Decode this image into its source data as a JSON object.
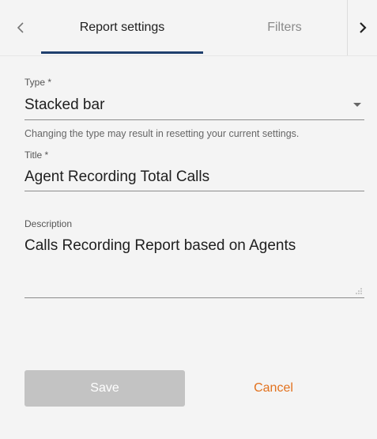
{
  "tabs": {
    "items": [
      {
        "label": "Report settings",
        "active": true
      },
      {
        "label": "Filters",
        "active": false
      }
    ]
  },
  "icons": {
    "prev": "chevron-left-icon",
    "next": "chevron-right-icon",
    "dropdown": "caret-down-icon",
    "resize": "resize-handle-icon"
  },
  "form": {
    "type": {
      "label": "Type *",
      "value": "Stacked bar",
      "helper": "Changing the type may result in resetting your current settings."
    },
    "title": {
      "label": "Title *",
      "value": "Agent Recording Total Calls"
    },
    "description": {
      "label": "Description",
      "value": "Calls Recording Report based on Agents"
    }
  },
  "actions": {
    "save_label": "Save",
    "cancel_label": "Cancel"
  },
  "colors": {
    "accent": "#1f3f6e",
    "cancel": "#e2711d",
    "save_disabled": "#c3c3c3",
    "background": "#f4f4f4"
  }
}
